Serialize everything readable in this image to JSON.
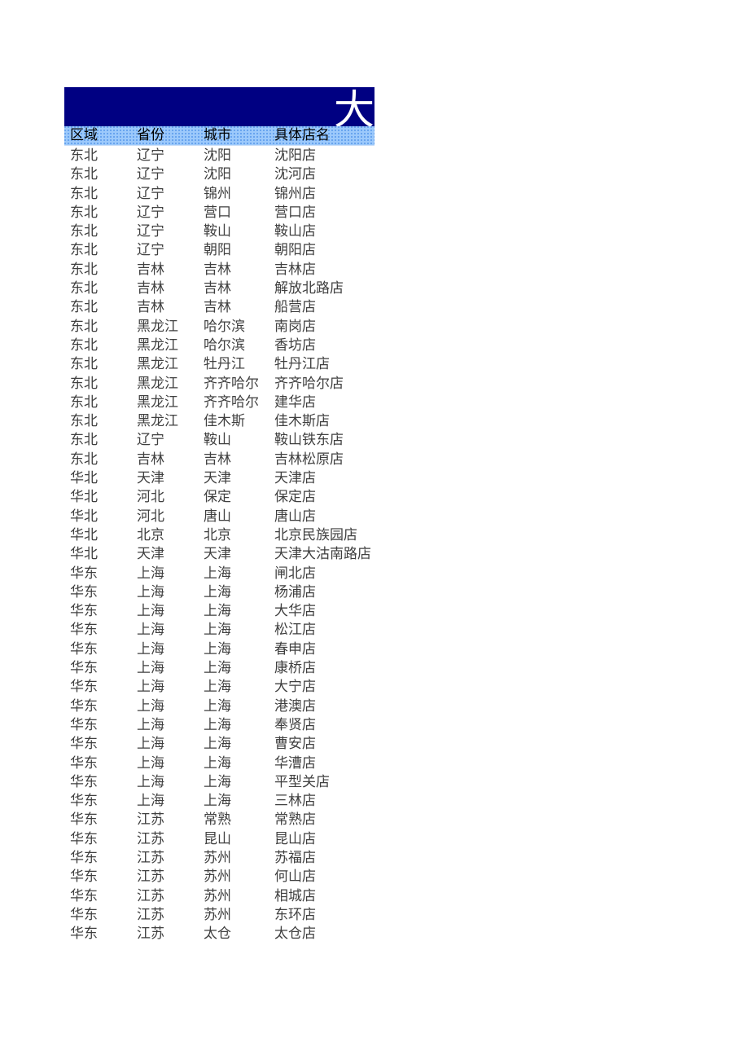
{
  "document": {
    "type": "spreadsheet-table",
    "title_bar": {
      "text": "大",
      "note_clipped": true,
      "background_color": "#000082",
      "text_color": "#FFFFFF"
    },
    "colors": {
      "title_background": "#000082",
      "header_row_background": "#9CC9FB",
      "page_background": "#FFFFFF",
      "header_text": "#000000",
      "body_text": "#3F3F3F"
    }
  },
  "table": {
    "columns": [
      {
        "key": "region",
        "label": "区域"
      },
      {
        "key": "province",
        "label": "省份"
      },
      {
        "key": "city",
        "label": "城市"
      },
      {
        "key": "store",
        "label": "具体店名"
      }
    ],
    "row_count": 42,
    "rows": [
      {
        "region": "东北",
        "province": "辽宁",
        "city": "沈阳",
        "store": "沈阳店"
      },
      {
        "region": "东北",
        "province": "辽宁",
        "city": "沈阳",
        "store": "沈河店"
      },
      {
        "region": "东北",
        "province": "辽宁",
        "city": "锦州",
        "store": "锦州店"
      },
      {
        "region": "东北",
        "province": "辽宁",
        "city": "营口",
        "store": "营口店"
      },
      {
        "region": "东北",
        "province": "辽宁",
        "city": "鞍山",
        "store": "鞍山店"
      },
      {
        "region": "东北",
        "province": "辽宁",
        "city": "朝阳",
        "store": "朝阳店"
      },
      {
        "region": "东北",
        "province": "吉林",
        "city": "吉林",
        "store": "吉林店"
      },
      {
        "region": "东北",
        "province": "吉林",
        "city": "吉林",
        "store": "解放北路店"
      },
      {
        "region": "东北",
        "province": "吉林",
        "city": "吉林",
        "store": "船营店"
      },
      {
        "region": "东北",
        "province": "黑龙江",
        "city": "哈尔滨",
        "store": "南岗店"
      },
      {
        "region": "东北",
        "province": "黑龙江",
        "city": "哈尔滨",
        "store": "香坊店"
      },
      {
        "region": "东北",
        "province": "黑龙江",
        "city": "牡丹江",
        "store": "牡丹江店"
      },
      {
        "region": "东北",
        "province": "黑龙江",
        "city": "齐齐哈尔",
        "store": "齐齐哈尔店"
      },
      {
        "region": "东北",
        "province": "黑龙江",
        "city": "齐齐哈尔",
        "store": "建华店"
      },
      {
        "region": "东北",
        "province": "黑龙江",
        "city": "佳木斯",
        "store": "佳木斯店"
      },
      {
        "region": "东北",
        "province": "辽宁",
        "city": "鞍山",
        "store": "鞍山铁东店"
      },
      {
        "region": "东北",
        "province": "吉林",
        "city": "吉林",
        "store": "吉林松原店"
      },
      {
        "region": "华北",
        "province": "天津",
        "city": "天津",
        "store": "天津店"
      },
      {
        "region": "华北",
        "province": "河北",
        "city": "保定",
        "store": "保定店"
      },
      {
        "region": "华北",
        "province": "河北",
        "city": "唐山",
        "store": "唐山店"
      },
      {
        "region": "华北",
        "province": "北京",
        "city": "北京",
        "store": "北京民族园店"
      },
      {
        "region": "华北",
        "province": "天津",
        "city": "天津",
        "store": "天津大沽南路店"
      },
      {
        "region": "华东",
        "province": "上海",
        "city": "上海",
        "store": "闸北店"
      },
      {
        "region": "华东",
        "province": "上海",
        "city": "上海",
        "store": "杨浦店"
      },
      {
        "region": "华东",
        "province": "上海",
        "city": "上海",
        "store": "大华店"
      },
      {
        "region": "华东",
        "province": "上海",
        "city": "上海",
        "store": "松江店"
      },
      {
        "region": "华东",
        "province": "上海",
        "city": "上海",
        "store": "春申店"
      },
      {
        "region": "华东",
        "province": "上海",
        "city": "上海",
        "store": "康桥店"
      },
      {
        "region": "华东",
        "province": "上海",
        "city": "上海",
        "store": "大宁店"
      },
      {
        "region": "华东",
        "province": "上海",
        "city": "上海",
        "store": "港澳店"
      },
      {
        "region": "华东",
        "province": "上海",
        "city": "上海",
        "store": "奉贤店"
      },
      {
        "region": "华东",
        "province": "上海",
        "city": "上海",
        "store": "曹安店"
      },
      {
        "region": "华东",
        "province": "上海",
        "city": "上海",
        "store": "华漕店"
      },
      {
        "region": "华东",
        "province": "上海",
        "city": "上海",
        "store": "平型关店"
      },
      {
        "region": "华东",
        "province": "上海",
        "city": "上海",
        "store": "三林店"
      },
      {
        "region": "华东",
        "province": "江苏",
        "city": "常熟",
        "store": "常熟店"
      },
      {
        "region": "华东",
        "province": "江苏",
        "city": "昆山",
        "store": "昆山店"
      },
      {
        "region": "华东",
        "province": "江苏",
        "city": "苏州",
        "store": "苏福店"
      },
      {
        "region": "华东",
        "province": "江苏",
        "city": "苏州",
        "store": "何山店"
      },
      {
        "region": "华东",
        "province": "江苏",
        "city": "苏州",
        "store": "相城店"
      },
      {
        "region": "华东",
        "province": "江苏",
        "city": "苏州",
        "store": "东环店"
      },
      {
        "region": "华东",
        "province": "江苏",
        "city": "太仓",
        "store": "太仓店"
      }
    ]
  }
}
